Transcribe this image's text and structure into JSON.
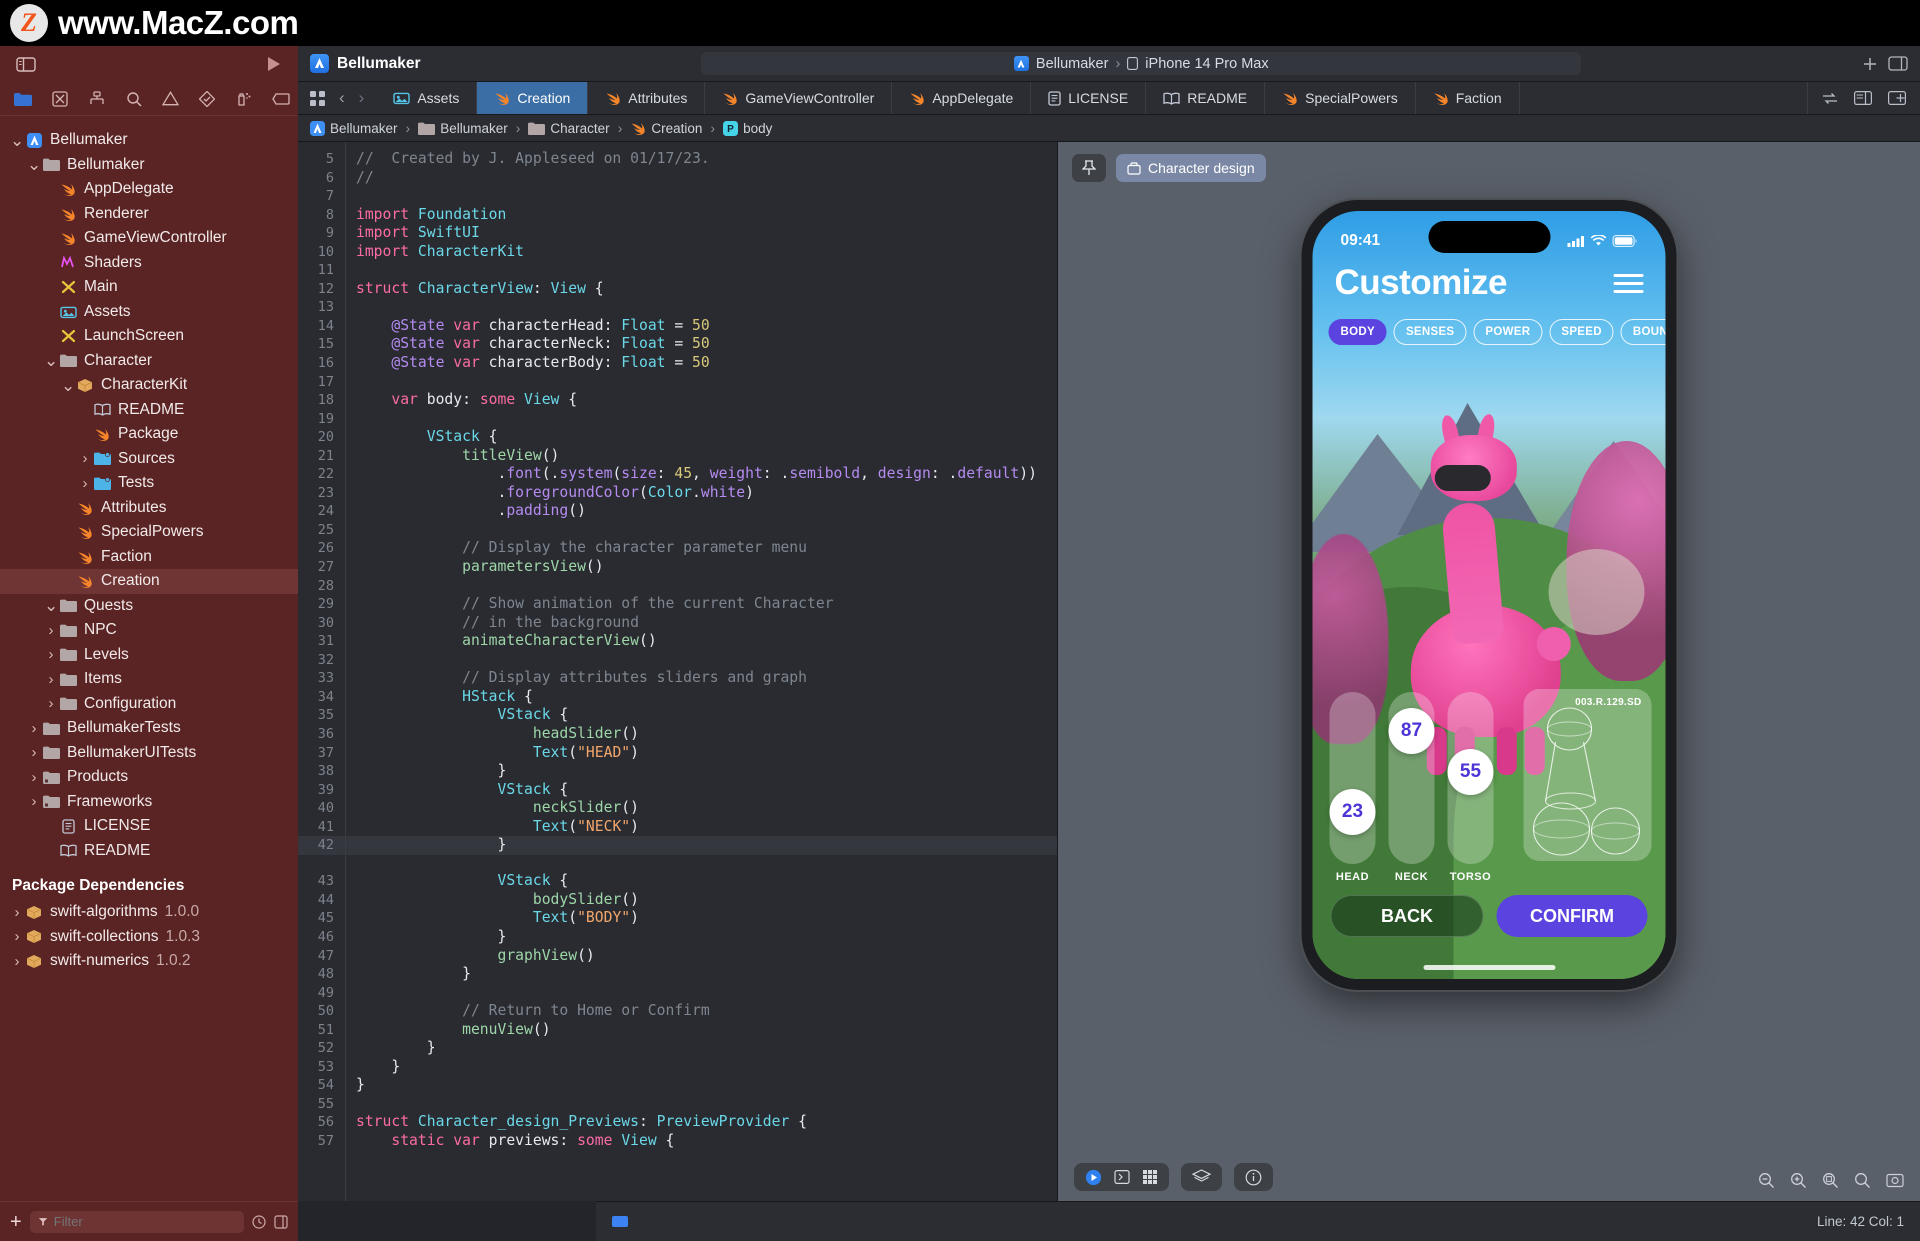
{
  "watermark": {
    "logo_letter": "Z",
    "url": "www.MacZ.com"
  },
  "nav_toolbar": {
    "sidebar_toggle_icon": "sidebar-icon",
    "run_icon": "play-icon",
    "icons": [
      "folder-icon",
      "source-control-icon",
      "hierarchy-icon",
      "search-icon",
      "warning-icon",
      "test-diamond-icon",
      "debug-icon",
      "breakpoint-icon",
      "report-icon"
    ]
  },
  "project": {
    "title": "Bellumaker",
    "scheme": {
      "target": "Bellumaker",
      "separator": "›",
      "destination": "iPhone 14 Pro Max"
    },
    "add_icon": "plus-icon",
    "layout_icon": "inspector-toggle-icon"
  },
  "sidebar": {
    "filter": {
      "placeholder": "Filter",
      "value": ""
    },
    "add_label": "+",
    "tree": [
      {
        "label": "Bellumaker",
        "icon": "app-icon",
        "indent": 0,
        "twisty": "down",
        "selected": false
      },
      {
        "label": "Bellumaker",
        "icon": "folder-icon",
        "indent": 1,
        "twisty": "down",
        "selected": false
      },
      {
        "label": "AppDelegate",
        "icon": "swift-icon",
        "indent": 2,
        "twisty": "",
        "selected": false
      },
      {
        "label": "Renderer",
        "icon": "swift-icon",
        "indent": 2,
        "twisty": "",
        "selected": false
      },
      {
        "label": "GameViewController",
        "icon": "swift-icon",
        "indent": 2,
        "twisty": "",
        "selected": false
      },
      {
        "label": "Shaders",
        "icon": "metal-icon",
        "indent": 2,
        "twisty": "",
        "selected": false
      },
      {
        "label": "Main",
        "icon": "storyboard-icon",
        "indent": 2,
        "twisty": "",
        "selected": false
      },
      {
        "label": "Assets",
        "icon": "assets-icon",
        "indent": 2,
        "twisty": "",
        "selected": false
      },
      {
        "label": "LaunchScreen",
        "icon": "storyboard-icon",
        "indent": 2,
        "twisty": "",
        "selected": false
      },
      {
        "label": "Character",
        "icon": "folder-icon",
        "indent": 2,
        "twisty": "down",
        "selected": false
      },
      {
        "label": "CharacterKit",
        "icon": "package-icon",
        "indent": 3,
        "twisty": "down",
        "selected": false
      },
      {
        "label": "README",
        "icon": "readme-icon",
        "indent": 4,
        "twisty": "",
        "selected": false
      },
      {
        "label": "Package",
        "icon": "swift-icon",
        "indent": 4,
        "twisty": "",
        "selected": false
      },
      {
        "label": "Sources",
        "icon": "blue-folder-icon",
        "indent": 4,
        "twisty": "right",
        "selected": false
      },
      {
        "label": "Tests",
        "icon": "blue-folder-icon",
        "indent": 4,
        "twisty": "right",
        "selected": false
      },
      {
        "label": "Attributes",
        "icon": "swift-icon",
        "indent": 3,
        "twisty": "",
        "selected": false
      },
      {
        "label": "SpecialPowers",
        "icon": "swift-icon",
        "indent": 3,
        "twisty": "",
        "selected": false
      },
      {
        "label": "Faction",
        "icon": "swift-icon",
        "indent": 3,
        "twisty": "",
        "selected": false
      },
      {
        "label": "Creation",
        "icon": "swift-icon",
        "indent": 3,
        "twisty": "",
        "selected": true
      },
      {
        "label": "Quests",
        "icon": "folder-icon",
        "indent": 2,
        "twisty": "down",
        "selected": false
      },
      {
        "label": "NPC",
        "icon": "folder-icon",
        "indent": 2,
        "twisty": "right",
        "selected": false
      },
      {
        "label": "Levels",
        "icon": "folder-icon",
        "indent": 2,
        "twisty": "right",
        "selected": false
      },
      {
        "label": "Items",
        "icon": "folder-icon",
        "indent": 2,
        "twisty": "right",
        "selected": false
      },
      {
        "label": "Configuration",
        "icon": "folder-icon",
        "indent": 2,
        "twisty": "right",
        "selected": false
      },
      {
        "label": "BellumakerTests",
        "icon": "folder-icon",
        "indent": 1,
        "twisty": "right",
        "selected": false
      },
      {
        "label": "BellumakerUITests",
        "icon": "folder-icon",
        "indent": 1,
        "twisty": "right",
        "selected": false
      },
      {
        "label": "Products",
        "icon": "products-folder-icon",
        "indent": 1,
        "twisty": "right",
        "selected": false
      },
      {
        "label": "Frameworks",
        "icon": "products-folder-icon",
        "indent": 1,
        "twisty": "right",
        "selected": false
      },
      {
        "label": "LICENSE",
        "icon": "license-icon",
        "indent": 2,
        "twisty": "",
        "selected": false
      },
      {
        "label": "README",
        "icon": "readme-icon",
        "indent": 2,
        "twisty": "",
        "selected": false
      }
    ],
    "dependencies_header": "Package Dependencies",
    "dependencies": [
      {
        "label": "swift-algorithms",
        "version": "1.0.0",
        "icon": "package-icon"
      },
      {
        "label": "swift-collections",
        "version": "1.0.3",
        "icon": "package-icon"
      },
      {
        "label": "swift-numerics",
        "version": "1.0.2",
        "icon": "package-icon"
      }
    ]
  },
  "tabs": [
    {
      "label": "Assets",
      "icon": "assets-icon",
      "active": false
    },
    {
      "label": "Creation",
      "icon": "swift-icon",
      "active": true
    },
    {
      "label": "Attributes",
      "icon": "swift-icon",
      "active": false
    },
    {
      "label": "GameViewController",
      "icon": "swift-icon",
      "active": false
    },
    {
      "label": "AppDelegate",
      "icon": "swift-icon",
      "active": false
    },
    {
      "label": "LICENSE",
      "icon": "license-icon",
      "active": false
    },
    {
      "label": "README",
      "icon": "readme-icon",
      "active": false
    },
    {
      "label": "SpecialPowers",
      "icon": "swift-icon",
      "active": false
    },
    {
      "label": "Faction",
      "icon": "swift-icon",
      "active": false
    }
  ],
  "breadcrumb": [
    {
      "label": "Bellumaker",
      "icon": "app-icon"
    },
    {
      "label": "Bellumaker",
      "icon": "folder-icon"
    },
    {
      "label": "Character",
      "icon": "folder-icon"
    },
    {
      "label": "Creation",
      "icon": "swift-icon"
    },
    {
      "label": "body",
      "icon": "property-icon"
    }
  ],
  "editor": {
    "first_line": 5,
    "current_line": 42,
    "lines": [
      "//  Created by J. Appleseed on 01/17/23.",
      "//",
      "",
      "import Foundation",
      "import SwiftUI",
      "import CharacterKit",
      "",
      "struct CharacterView: View {",
      "",
      "    @State var characterHead: Float = 50",
      "    @State var characterNeck: Float = 50",
      "    @State var characterBody: Float = 50",
      "",
      "    var body: some View {",
      "",
      "        VStack {",
      "            titleView()",
      "                .font(.system(size: 45, weight: .semibold, design: .default))",
      "                .foregroundColor(Color.white)",
      "                .padding()",
      "",
      "            // Display the character parameter menu",
      "            parametersView()",
      "",
      "            // Show animation of the current Character",
      "            // in the background",
      "            animateCharacterView()",
      "",
      "            // Display attributes sliders and graph",
      "            HStack {",
      "                VStack {",
      "                    headSlider()",
      "                    Text(\"HEAD\")",
      "                }",
      "                VStack {",
      "                    neckSlider()",
      "                    Text(\"NECK\")",
      "                }",
      "                VStack {",
      "                    bodySlider()",
      "                    Text(\"BODY\")",
      "                }",
      "                graphView()",
      "            }",
      "",
      "            // Return to Home or Confirm",
      "            menuView()",
      "        }",
      "    }",
      "}",
      "",
      "struct Character_design_Previews: PreviewProvider {",
      "    static var previews: some View {"
    ]
  },
  "preview": {
    "pin_icon": "pin-icon",
    "design_label": "Character design",
    "design_icon": "preview-box-icon",
    "bottom_controls": {
      "play_icon": "play-circle-icon",
      "device_icon": "device-icon",
      "grid_icon": "grid-icon",
      "layers_icon": "layers-icon",
      "info_icon": "info-circle-icon"
    },
    "zoom_controls": [
      "zoom-out-icon",
      "zoom-in-icon",
      "zoom-fit-icon",
      "zoom-actual-icon",
      "screenshot-icon"
    ]
  },
  "phone_app": {
    "status_time": "09:41",
    "status_icons": [
      "cellular-icon",
      "wifi-icon",
      "battery-icon"
    ],
    "title": "Customize",
    "menu_icon": "hamburger-menu-icon",
    "pills": [
      {
        "label": "BODY",
        "active": true
      },
      {
        "label": "SENSES",
        "active": false
      },
      {
        "label": "POWER",
        "active": false
      },
      {
        "label": "SPEED",
        "active": false
      },
      {
        "label": "BOUNCE",
        "active": false
      }
    ],
    "sliders": [
      {
        "label": "HEAD",
        "value": "23",
        "percent": 23
      },
      {
        "label": "NECK",
        "value": "87",
        "percent": 87
      },
      {
        "label": "TORSO",
        "value": "55",
        "percent": 55
      }
    ],
    "graph_code": "003.R.129.SD",
    "buttons": {
      "back": "BACK",
      "confirm": "CONFIRM"
    },
    "accent_color": "#5b43e0"
  },
  "status_bar": {
    "line_col": "Line: 42  Col: 1"
  }
}
